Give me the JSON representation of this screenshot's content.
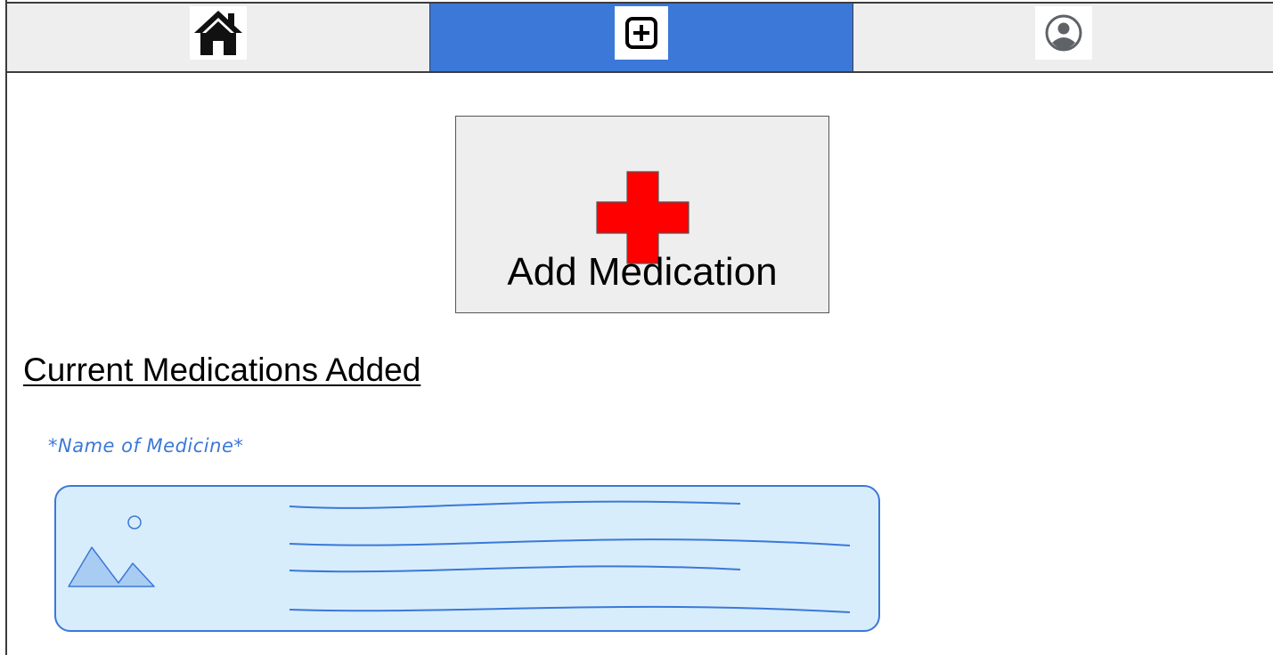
{
  "nav": {
    "tabs": [
      {
        "name": "home",
        "icon": "home-icon",
        "active": false
      },
      {
        "name": "add",
        "icon": "plus-square-icon",
        "active": true
      },
      {
        "name": "profile",
        "icon": "user-circle-icon",
        "active": false
      }
    ],
    "active_color": "#3b78d8",
    "inactive_color": "#eeeeee"
  },
  "add_medication": {
    "label": "Add Medication",
    "icon": "red-cross-icon",
    "icon_color": "#ff0000"
  },
  "current_medications": {
    "heading": "Current Medications Added",
    "items": [
      {
        "name": "*Name of Medicine*",
        "image": "image-placeholder-icon"
      }
    ]
  },
  "colors": {
    "accent": "#3b78d8",
    "card_background": "#d8edfb"
  }
}
